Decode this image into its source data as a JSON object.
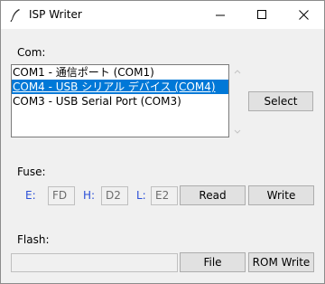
{
  "window": {
    "title": "ISP Writer",
    "icon": "feather-icon",
    "controls": [
      "minimize-icon",
      "maximize-icon",
      "close-icon"
    ]
  },
  "com": {
    "label": "Com:",
    "ports": [
      {
        "text": "COM1 - 通信ポート (COM1)",
        "selected": false
      },
      {
        "text": "COM4 - USB シリアル デバイス (COM4)",
        "selected": true
      },
      {
        "text": "COM3 - USB Serial Port (COM3)",
        "selected": false
      }
    ],
    "select_label": "Select"
  },
  "fuse": {
    "label": "Fuse:",
    "e_label": "E:",
    "e_value": "FD",
    "h_label": "H:",
    "h_value": "D2",
    "l_label": "L:",
    "l_value": "E2",
    "read_label": "Read",
    "write_label": "Write"
  },
  "flash": {
    "label": "Flash:",
    "path_value": "",
    "file_label": "File",
    "rom_write_label": "ROM Write"
  },
  "colors": {
    "selection": "#0078d7",
    "fuse_letters": "#2a4fd8"
  }
}
